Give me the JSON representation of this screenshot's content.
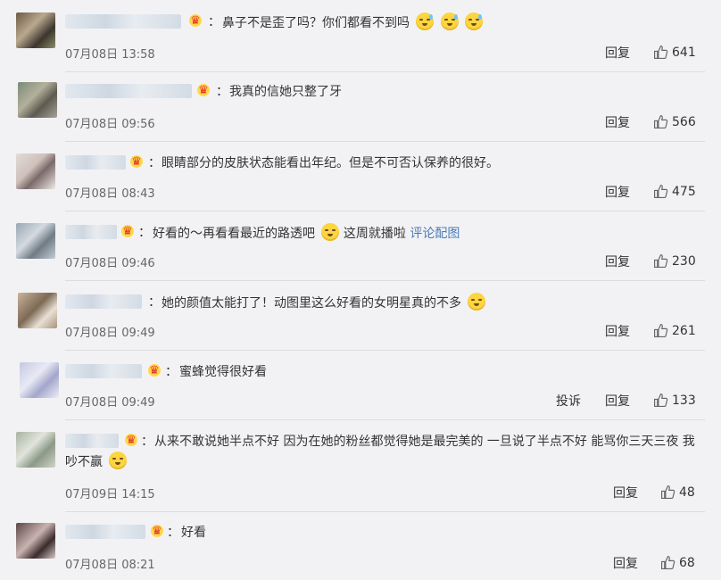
{
  "comments": [
    {
      "text": "鼻子不是歪了吗？你们都看不到吗",
      "emojis": 3,
      "time": "07月08日 13:58",
      "reply": "回复",
      "likes": "641",
      "report": ""
    },
    {
      "text": "我真的信她只整了牙",
      "emojis": 0,
      "time": "07月08日 09:56",
      "reply": "回复",
      "likes": "566",
      "report": ""
    },
    {
      "text": "眼睛部分的皮肤状态能看出年纪。但是不可否认保养的很好。",
      "emojis": 0,
      "time": "07月08日 08:43",
      "reply": "回复",
      "likes": "475",
      "report": ""
    },
    {
      "text": "好看的～再看看最近的路透吧",
      "text2": "这周就播啦",
      "link": "评论配图",
      "emojis": 1,
      "time": "07月08日 09:46",
      "reply": "回复",
      "likes": "230",
      "report": ""
    },
    {
      "text": "她的颜值太能打了！动图里这么好看的女明星真的不多",
      "emojis": 1,
      "time": "07月08日 09:49",
      "reply": "回复",
      "likes": "261",
      "report": ""
    },
    {
      "text": "蜜蜂觉得很好看",
      "emojis": 0,
      "time": "07月08日 09:49",
      "reply": "回复",
      "likes": "133",
      "report": "投诉"
    },
    {
      "text": "从来不敢说她半点不好 因为在她的粉丝都觉得她是最完美的 一旦说了半点不好 能骂你三天三夜 我吵不赢",
      "emojis": 1,
      "time": "07月09日 14:15",
      "reply": "回复",
      "likes": "48",
      "report": ""
    },
    {
      "text": "好看",
      "emojis": 0,
      "time": "07月08日 08:21",
      "reply": "回复",
      "likes": "68",
      "report": ""
    }
  ],
  "colon": "：",
  "colors": {
    "background": "#f2f2f5",
    "link": "#4a7cb6",
    "text": "#333333",
    "meta": "#666666",
    "crown": "#ffd84a"
  },
  "icons": {
    "like": "thumbs-up-icon",
    "vip": "crown-icon",
    "emoji": "emoji-face-icon"
  }
}
